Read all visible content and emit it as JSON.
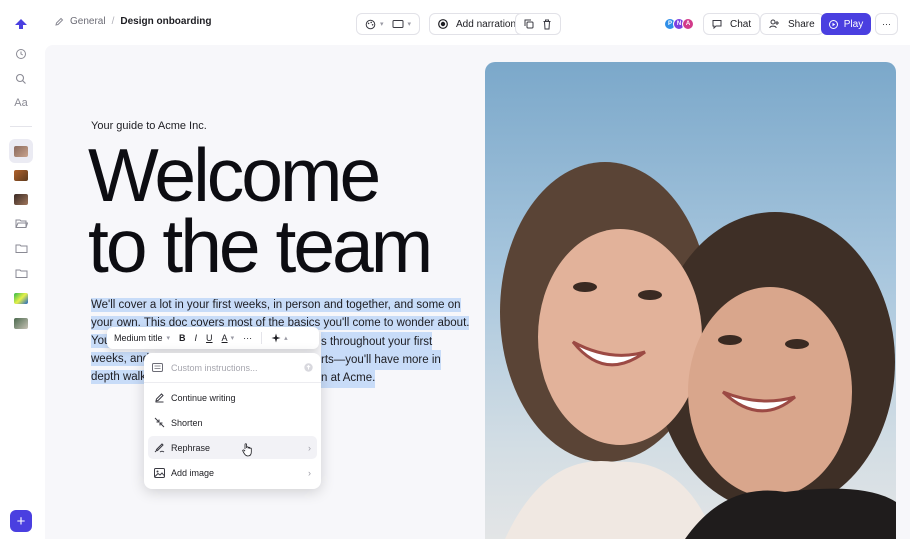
{
  "breadcrumb": {
    "parent": "General",
    "separator": "/",
    "current": "Design onboarding"
  },
  "toolbar": {
    "add_narration": "Add narration",
    "chat": "Chat",
    "share": "Share",
    "play": "Play",
    "more": "···"
  },
  "collaborators": [
    {
      "initial": "P",
      "color": "#2f8fe8"
    },
    {
      "initial": "N",
      "color": "#7b3fe0"
    },
    {
      "initial": "A",
      "color": "#d23a8a"
    }
  ],
  "sidebar": {
    "font_label": "Aa",
    "add": "+"
  },
  "document": {
    "kicker": "Your guide to Acme Inc.",
    "headline_line1": "Welcome",
    "headline_line2": "to the team",
    "body_line1": "We'll cover a lot in your first weeks, in person and together, and some on",
    "body_line2": "your own. This doc covers most of the basics you'll come to wonder about.",
    "body_line3_start": "You",
    "body_line3_end": "s throughout your first",
    "body_line4_start": "weeks, and",
    "body_line4_end": "rts—you'll have more in",
    "body_line5_start": "depth walk-",
    "body_line5_end": "n at Acme."
  },
  "format_toolbar": {
    "style": "Medium title",
    "bold": "B",
    "italic": "I",
    "underline": "U",
    "color": "A",
    "more": "···"
  },
  "ai_menu": {
    "placeholder": "Custom instructions...",
    "items": [
      {
        "label": "Continue writing",
        "submenu": false
      },
      {
        "label": "Shorten",
        "submenu": false
      },
      {
        "label": "Rephrase",
        "submenu": true
      },
      {
        "label": "Add image",
        "submenu": true
      }
    ],
    "submenu_arrow": "›"
  },
  "colors": {
    "accent": "#4a3fe0",
    "selection": "#c8dcf8"
  }
}
